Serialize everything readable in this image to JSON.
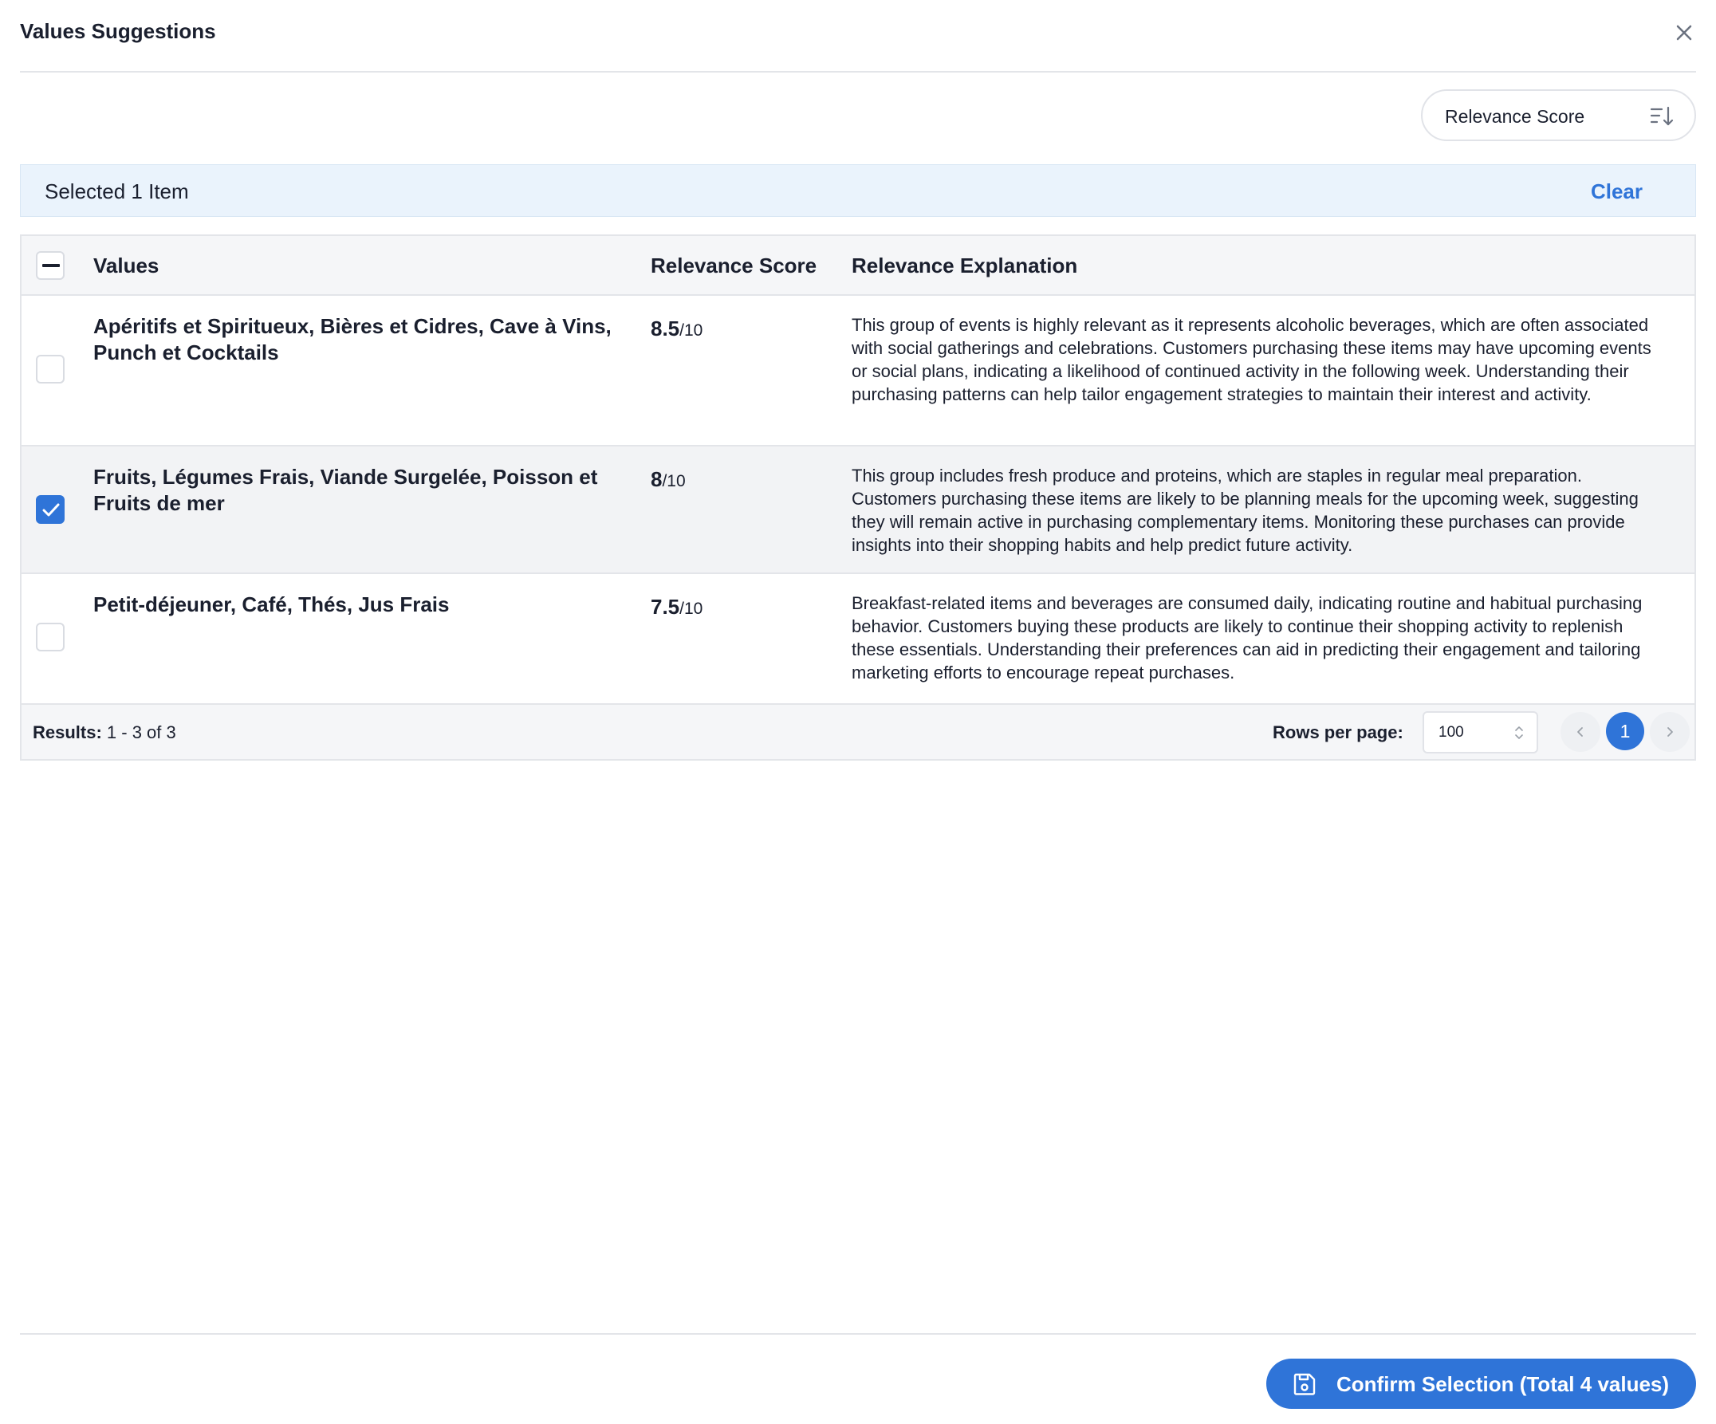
{
  "dialog": {
    "title": "Values Suggestions",
    "close_icon": "close-icon"
  },
  "sort": {
    "label": "Relevance Score",
    "icon": "sort-descending-icon"
  },
  "selection": {
    "text": "Selected 1 Item",
    "clear_label": "Clear"
  },
  "table": {
    "headers": {
      "values": "Values",
      "score": "Relevance Score",
      "explanation": "Relevance Explanation"
    },
    "rows": [
      {
        "value": "Apéritifs et Spiritueux, Bières et Cidres, Cave à Vins, Punch et Cocktails",
        "score": "8.5",
        "score_denominator": "/10",
        "explanation": "This group of events is highly relevant as it represents alcoholic beverages, which are often associated with social gatherings and celebrations. Customers purchasing these items may have upcoming events or social plans, indicating a likelihood of continued activity in the following week. Understanding their purchasing patterns can help tailor engagement strategies to maintain their interest and activity.",
        "selected": false
      },
      {
        "value": "Fruits, Légumes Frais, Viande Surgelée, Poisson et Fruits de mer",
        "score": "8",
        "score_denominator": "/10",
        "explanation": "This group includes fresh produce and proteins, which are staples in regular meal preparation. Customers purchasing these items are likely to be planning meals for the upcoming week, suggesting they will remain active in purchasing complementary items. Monitoring these purchases can provide insights into their shopping habits and help predict future activity.",
        "selected": true
      },
      {
        "value": "Petit-déjeuner, Café, Thés, Jus Frais",
        "score": "7.5",
        "score_denominator": "/10",
        "explanation": "Breakfast-related items and beverages are consumed daily, indicating routine and habitual purchasing behavior. Customers buying these products are likely to continue their shopping activity to replenish these essentials. Understanding their preferences can aid in predicting their engagement and tailoring marketing efforts to encourage repeat purchases.",
        "selected": false
      }
    ]
  },
  "footer": {
    "results_label": "Results:",
    "results_range": "1 - 3 of 3",
    "rows_per_page_label": "Rows per page:",
    "rows_per_page_value": "100",
    "current_page": "1"
  },
  "confirm": {
    "label": "Confirm Selection (Total 4 values)",
    "icon": "save-icon"
  },
  "colors": {
    "accent": "#2f74d8",
    "selection_bar": "#eaf3fc",
    "header_bg": "#f5f6f8",
    "selected_row": "#f2f3f5",
    "border": "#e3e5e9"
  }
}
